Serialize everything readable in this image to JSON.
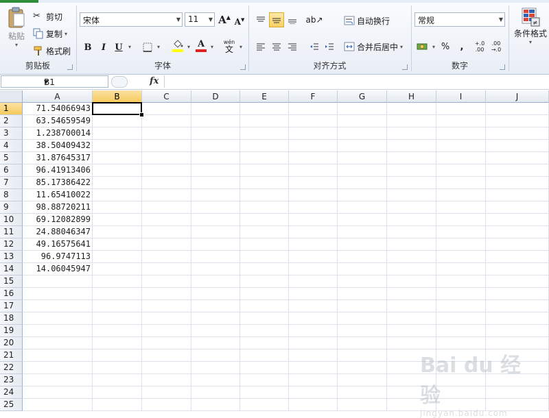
{
  "ribbon": {
    "clipboard": {
      "paste_label": "粘贴",
      "cut_label": "剪切",
      "copy_label": "复制",
      "format_painter_label": "格式刷",
      "group_label": "剪贴板"
    },
    "font": {
      "font_name": "宋体",
      "font_size": "11",
      "bold": "B",
      "italic": "I",
      "underline": "U",
      "font_color_glyph": "A",
      "phonetic_glyph": "wén",
      "phonetic_char": "文",
      "group_label": "字体"
    },
    "alignment": {
      "wrap_text_label": "自动换行",
      "merge_center_label": "合并后居中",
      "group_label": "对齐方式"
    },
    "number": {
      "format_value": "常规",
      "percent": "%",
      "comma": ",",
      "inc_decimal": "+.0 .00",
      "dec_decimal": ".00 →.0",
      "group_label": "数字"
    },
    "styles": {
      "conditional_format_label": "条件格式"
    }
  },
  "formula_bar": {
    "name_box": "B1",
    "fx": "fx",
    "formula": ""
  },
  "sheet": {
    "columns": [
      "A",
      "B",
      "C",
      "D",
      "E",
      "F",
      "G",
      "H",
      "I",
      "J"
    ],
    "selected_column": "B",
    "selected_row": 1,
    "rows": [
      1,
      2,
      3,
      4,
      5,
      6,
      7,
      8,
      9,
      10,
      11,
      12,
      13,
      14,
      15,
      16,
      17,
      18,
      19,
      20,
      21,
      22,
      23,
      24,
      25
    ],
    "values_A": [
      "71.54066943",
      "63.54659549",
      "1.238700014",
      "38.50409432",
      "31.87645317",
      "96.41913406",
      "85.17386422",
      "11.65410022",
      "98.88720211",
      "69.12082899",
      "24.88046347",
      "49.16575641",
      "96.9747113",
      "14.06045947"
    ]
  },
  "watermark": {
    "brand": "Bai du 经验",
    "url": "jingyan.baidu.com"
  },
  "colors": {
    "accent_selected_header": "#f7c95c",
    "ribbon_bg": "#e9eef6",
    "font_color_bar": "#e02020",
    "fill_color_bar": "#ffff00"
  }
}
